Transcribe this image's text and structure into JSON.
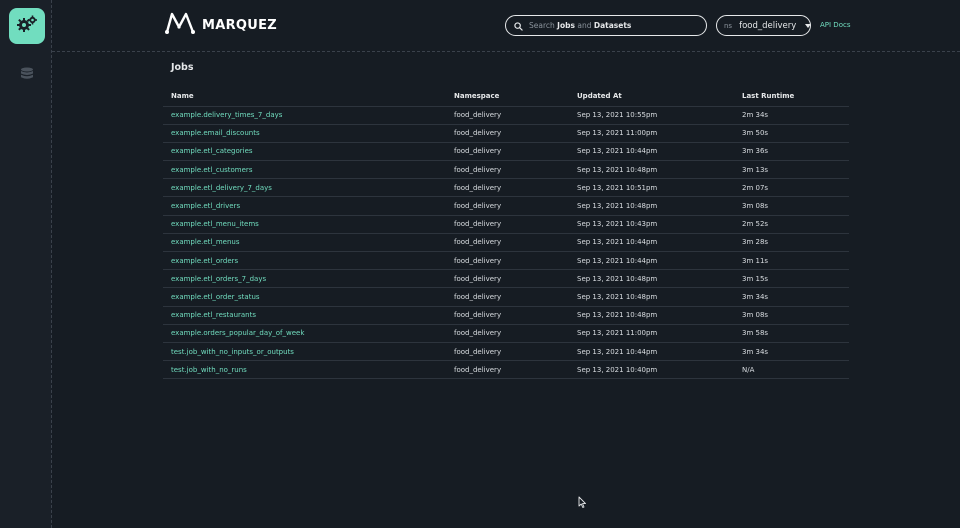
{
  "app": {
    "name": "MARQUEZ"
  },
  "search": {
    "prefix": "Search",
    "jobs": "Jobs",
    "and": "and",
    "datasets": "Datasets"
  },
  "namespace": {
    "prefix": "ns",
    "value": "food_delivery"
  },
  "header": {
    "api_docs": "API Docs"
  },
  "page": {
    "title": "Jobs"
  },
  "table": {
    "columns": [
      "Name",
      "Namespace",
      "Updated At",
      "Last Runtime"
    ],
    "rows": [
      [
        "example.delivery_times_7_days",
        "food_delivery",
        "Sep 13, 2021 10:55pm",
        "2m 34s"
      ],
      [
        "example.email_discounts",
        "food_delivery",
        "Sep 13, 2021 11:00pm",
        "3m 50s"
      ],
      [
        "example.etl_categories",
        "food_delivery",
        "Sep 13, 2021 10:44pm",
        "3m 36s"
      ],
      [
        "example.etl_customers",
        "food_delivery",
        "Sep 13, 2021 10:48pm",
        "3m 13s"
      ],
      [
        "example.etl_delivery_7_days",
        "food_delivery",
        "Sep 13, 2021 10:51pm",
        "2m 07s"
      ],
      [
        "example.etl_drivers",
        "food_delivery",
        "Sep 13, 2021 10:48pm",
        "3m 08s"
      ],
      [
        "example.etl_menu_items",
        "food_delivery",
        "Sep 13, 2021 10:43pm",
        "2m 52s"
      ],
      [
        "example.etl_menus",
        "food_delivery",
        "Sep 13, 2021 10:44pm",
        "3m 28s"
      ],
      [
        "example.etl_orders",
        "food_delivery",
        "Sep 13, 2021 10:44pm",
        "3m 11s"
      ],
      [
        "example.etl_orders_7_days",
        "food_delivery",
        "Sep 13, 2021 10:48pm",
        "3m 15s"
      ],
      [
        "example.etl_order_status",
        "food_delivery",
        "Sep 13, 2021 10:48pm",
        "3m 34s"
      ],
      [
        "example.etl_restaurants",
        "food_delivery",
        "Sep 13, 2021 10:48pm",
        "3m 08s"
      ],
      [
        "example.orders_popular_day_of_week",
        "food_delivery",
        "Sep 13, 2021 11:00pm",
        "3m 58s"
      ],
      [
        "test.job_with_no_inputs_or_outputs",
        "food_delivery",
        "Sep 13, 2021 10:44pm",
        "3m 34s"
      ],
      [
        "test.job_with_no_runs",
        "food_delivery",
        "Sep 13, 2021 10:40pm",
        "N/A"
      ]
    ]
  },
  "icons": {
    "sidebar_jobs": "gears-icon",
    "sidebar_datasets": "database-icon",
    "search": "search-icon",
    "logo": "marquez-logo-icon"
  },
  "colors": {
    "accent": "#71ddbf",
    "background": "#161c23",
    "text": "#e6e8ea"
  }
}
